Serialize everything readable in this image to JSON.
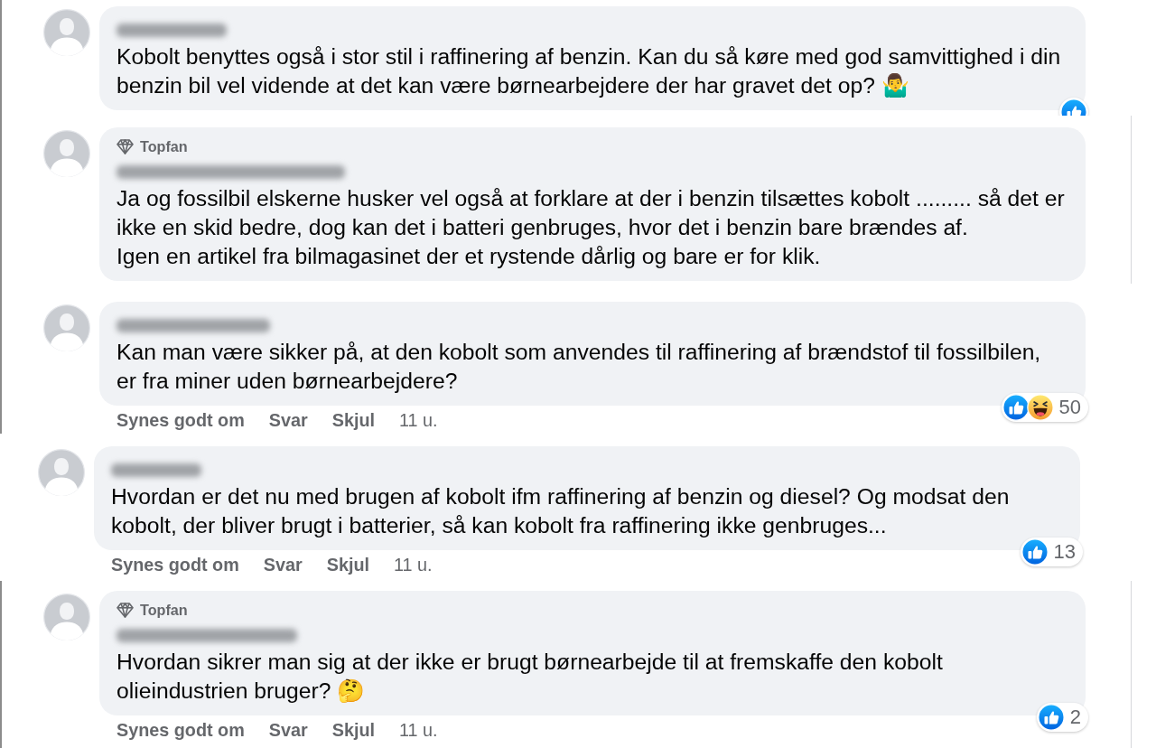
{
  "comments": [
    {
      "text": "Kobolt benyttes også i stor stil i raffinering af benzin. Kan du så køre med god samvittighed i din benzin bil vel vidende at det kan være børnearbejdere der har gravet det op? 🤷‍♂️",
      "reactions": [
        {
          "kind": "like"
        }
      ]
    },
    {
      "badge": "Topfan",
      "text": "Ja og fossilbil elskerne husker vel også at forklare at der i benzin tilsættes kobolt ......... så det er ikke en skid bedre, dog kan det i batteri genbruges, hvor det i benzin bare brændes af.\nIgen en artikel fra bilmagasinet der et rystende dårlig og bare er for klik."
    },
    {
      "text": "Kan man være sikker på, at den kobolt som anvendes til raffinering af brændstof til fossilbilen, er fra miner uden børnearbejdere?",
      "reactions": [
        {
          "kind": "like"
        },
        {
          "kind": "haha"
        }
      ],
      "reaction_count": "50",
      "actions": [
        "Synes godt om",
        "Svar",
        "Skjul"
      ],
      "time": "11 u."
    },
    {
      "text": "Hvordan er det nu med brugen af kobolt ifm raffinering af benzin og diesel? Og modsat den kobolt, der bliver brugt i batterier, så kan kobolt fra raffinering ikke genbruges...",
      "reactions": [
        {
          "kind": "like"
        }
      ],
      "reaction_count": "13",
      "actions": [
        "Synes godt om",
        "Svar",
        "Skjul"
      ],
      "time": "11 u."
    },
    {
      "badge": "Topfan",
      "text": "Hvordan sikrer man sig at der ikke er brugt børnearbejde til at fremskaffe den kobolt olieindustrien bruger? 🤔",
      "reactions": [
        {
          "kind": "like"
        }
      ],
      "reaction_count": "2",
      "actions": [
        "Synes godt om",
        "Svar",
        "Skjul"
      ],
      "time": "11 u."
    }
  ]
}
